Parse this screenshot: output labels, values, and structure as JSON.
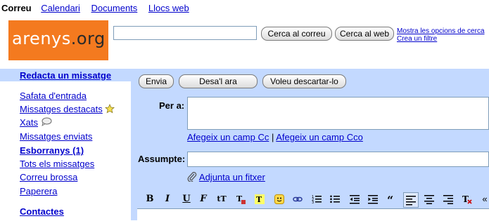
{
  "topnav": {
    "current": "Correu",
    "items": [
      "Calendari",
      "Documents",
      "Llocs web"
    ]
  },
  "logo": {
    "text_main": "arenys",
    "text_dot": ".",
    "text_org": "org"
  },
  "search": {
    "input_value": "",
    "mail_button": "Cerca al correu",
    "web_button": "Cerca al web",
    "options_link": "Mostra les opcions de cerca",
    "filter_link": "Crea un filtre"
  },
  "sidebar": {
    "compose": "Redacta un missatge",
    "items": [
      {
        "label": "Safata d'entrada",
        "bold": false
      },
      {
        "label": "Missatges destacats",
        "bold": false,
        "icon": "star-icon"
      },
      {
        "label": "Xats",
        "bold": false,
        "icon": "chat-bubble-icon"
      },
      {
        "label": "Missatges enviats",
        "bold": false
      },
      {
        "label": "Esborranys (1)",
        "bold": true
      },
      {
        "label": "Tots els missatges",
        "bold": false
      },
      {
        "label": "Correu brossa",
        "bold": false
      },
      {
        "label": "Paperera",
        "bold": false
      }
    ],
    "contacts": "Contactes"
  },
  "compose": {
    "send_button": "Envia",
    "save_button": "Desa'l ara",
    "discard_button": "Voleu descartar-lo",
    "to_label": "Per a:",
    "to_value": "",
    "add_cc": "Afegeix un camp Cc",
    "separator": "|",
    "add_bcc": "Afegeix un camp Cco",
    "subject_label": "Assumpte:",
    "subject_value": "",
    "attach_link": "Adjunta un fitxer"
  },
  "toolbar": {
    "bold": "B",
    "italic": "I",
    "underline": "U",
    "font": "F",
    "size": "tT",
    "more": "«"
  },
  "colors": {
    "accent_bg": "#c3d9ff",
    "link": "#0000cc",
    "logo_bg": "#f47a1f"
  }
}
